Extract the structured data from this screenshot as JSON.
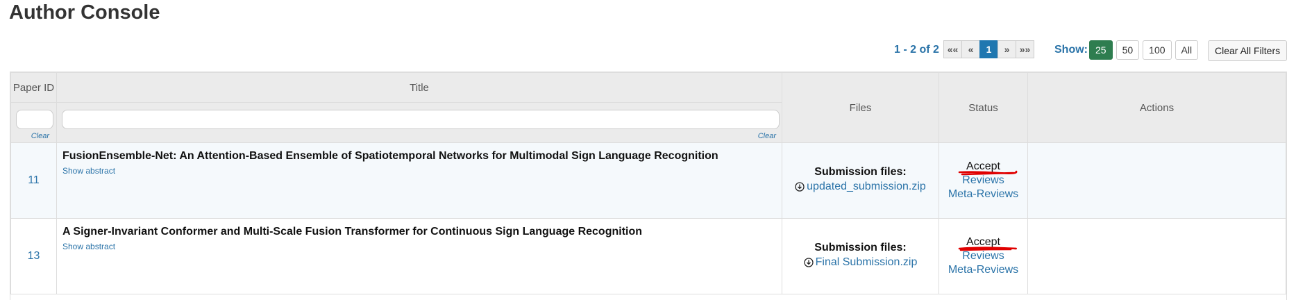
{
  "page": {
    "title": "Author Console"
  },
  "toolbar": {
    "range": "1 - 2 of 2",
    "pager": [
      "««",
      "«",
      "1",
      "»",
      "»»"
    ],
    "show_label": "Show:",
    "sizes": [
      "25",
      "50",
      "100",
      "All"
    ],
    "clear_all": "Clear All Filters"
  },
  "table": {
    "headers": {
      "paper_id": "Paper ID",
      "title": "Title",
      "files": "Files",
      "status": "Status",
      "actions": "Actions"
    },
    "filters": {
      "clear": "Clear"
    },
    "rows": [
      {
        "id": "11",
        "title": "FusionEnsemble-Net: An Attention-Based Ensemble of Spatiotemporal Networks for Multimodal Sign Language Recognition",
        "show_abstract": "Show abstract",
        "files_label": "Submission files:",
        "file": "updated_submission.zip",
        "status": "Accept",
        "reviews": "Reviews",
        "meta_reviews": "Meta-Reviews"
      },
      {
        "id": "13",
        "title": "A Signer-Invariant Conformer and Multi-Scale Fusion Transformer for Continuous Sign Language Recognition",
        "show_abstract": "Show abstract",
        "files_label": "Submission files:",
        "file": "Final Submission.zip",
        "status": "Accept",
        "reviews": "Reviews",
        "meta_reviews": "Meta-Reviews"
      }
    ]
  },
  "colors": {
    "accent": "#2a73a8",
    "active_page": "#1f77b0",
    "active_size": "#2e7d4f",
    "annotation": "#e00000"
  },
  "icons": {
    "file": "download-circle-icon"
  }
}
